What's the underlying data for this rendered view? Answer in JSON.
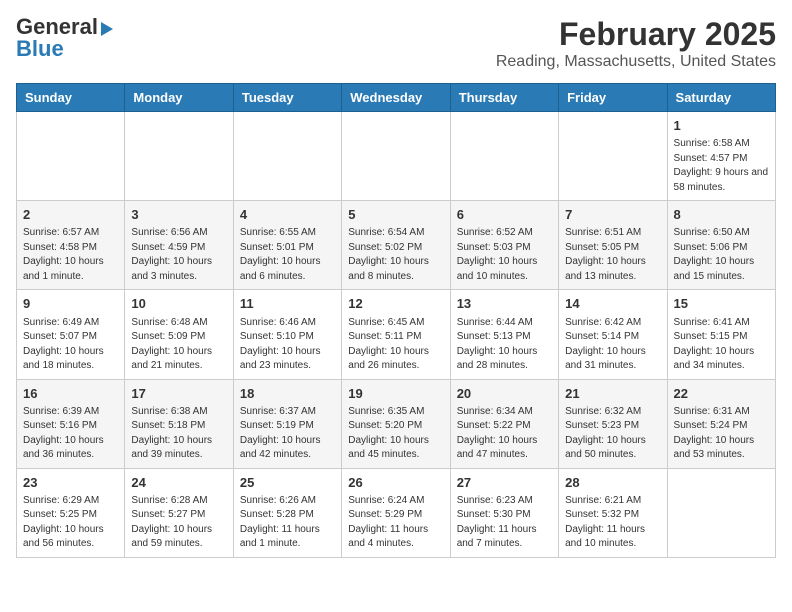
{
  "header": {
    "logo_general": "General",
    "logo_blue": "Blue",
    "month": "February 2025",
    "location": "Reading, Massachusetts, United States"
  },
  "weekdays": [
    "Sunday",
    "Monday",
    "Tuesday",
    "Wednesday",
    "Thursday",
    "Friday",
    "Saturday"
  ],
  "weeks": [
    [
      {
        "day": "",
        "info": ""
      },
      {
        "day": "",
        "info": ""
      },
      {
        "day": "",
        "info": ""
      },
      {
        "day": "",
        "info": ""
      },
      {
        "day": "",
        "info": ""
      },
      {
        "day": "",
        "info": ""
      },
      {
        "day": "1",
        "info": "Sunrise: 6:58 AM\nSunset: 4:57 PM\nDaylight: 9 hours and 58 minutes."
      }
    ],
    [
      {
        "day": "2",
        "info": "Sunrise: 6:57 AM\nSunset: 4:58 PM\nDaylight: 10 hours and 1 minute."
      },
      {
        "day": "3",
        "info": "Sunrise: 6:56 AM\nSunset: 4:59 PM\nDaylight: 10 hours and 3 minutes."
      },
      {
        "day": "4",
        "info": "Sunrise: 6:55 AM\nSunset: 5:01 PM\nDaylight: 10 hours and 6 minutes."
      },
      {
        "day": "5",
        "info": "Sunrise: 6:54 AM\nSunset: 5:02 PM\nDaylight: 10 hours and 8 minutes."
      },
      {
        "day": "6",
        "info": "Sunrise: 6:52 AM\nSunset: 5:03 PM\nDaylight: 10 hours and 10 minutes."
      },
      {
        "day": "7",
        "info": "Sunrise: 6:51 AM\nSunset: 5:05 PM\nDaylight: 10 hours and 13 minutes."
      },
      {
        "day": "8",
        "info": "Sunrise: 6:50 AM\nSunset: 5:06 PM\nDaylight: 10 hours and 15 minutes."
      }
    ],
    [
      {
        "day": "9",
        "info": "Sunrise: 6:49 AM\nSunset: 5:07 PM\nDaylight: 10 hours and 18 minutes."
      },
      {
        "day": "10",
        "info": "Sunrise: 6:48 AM\nSunset: 5:09 PM\nDaylight: 10 hours and 21 minutes."
      },
      {
        "day": "11",
        "info": "Sunrise: 6:46 AM\nSunset: 5:10 PM\nDaylight: 10 hours and 23 minutes."
      },
      {
        "day": "12",
        "info": "Sunrise: 6:45 AM\nSunset: 5:11 PM\nDaylight: 10 hours and 26 minutes."
      },
      {
        "day": "13",
        "info": "Sunrise: 6:44 AM\nSunset: 5:13 PM\nDaylight: 10 hours and 28 minutes."
      },
      {
        "day": "14",
        "info": "Sunrise: 6:42 AM\nSunset: 5:14 PM\nDaylight: 10 hours and 31 minutes."
      },
      {
        "day": "15",
        "info": "Sunrise: 6:41 AM\nSunset: 5:15 PM\nDaylight: 10 hours and 34 minutes."
      }
    ],
    [
      {
        "day": "16",
        "info": "Sunrise: 6:39 AM\nSunset: 5:16 PM\nDaylight: 10 hours and 36 minutes."
      },
      {
        "day": "17",
        "info": "Sunrise: 6:38 AM\nSunset: 5:18 PM\nDaylight: 10 hours and 39 minutes."
      },
      {
        "day": "18",
        "info": "Sunrise: 6:37 AM\nSunset: 5:19 PM\nDaylight: 10 hours and 42 minutes."
      },
      {
        "day": "19",
        "info": "Sunrise: 6:35 AM\nSunset: 5:20 PM\nDaylight: 10 hours and 45 minutes."
      },
      {
        "day": "20",
        "info": "Sunrise: 6:34 AM\nSunset: 5:22 PM\nDaylight: 10 hours and 47 minutes."
      },
      {
        "day": "21",
        "info": "Sunrise: 6:32 AM\nSunset: 5:23 PM\nDaylight: 10 hours and 50 minutes."
      },
      {
        "day": "22",
        "info": "Sunrise: 6:31 AM\nSunset: 5:24 PM\nDaylight: 10 hours and 53 minutes."
      }
    ],
    [
      {
        "day": "23",
        "info": "Sunrise: 6:29 AM\nSunset: 5:25 PM\nDaylight: 10 hours and 56 minutes."
      },
      {
        "day": "24",
        "info": "Sunrise: 6:28 AM\nSunset: 5:27 PM\nDaylight: 10 hours and 59 minutes."
      },
      {
        "day": "25",
        "info": "Sunrise: 6:26 AM\nSunset: 5:28 PM\nDaylight: 11 hours and 1 minute."
      },
      {
        "day": "26",
        "info": "Sunrise: 6:24 AM\nSunset: 5:29 PM\nDaylight: 11 hours and 4 minutes."
      },
      {
        "day": "27",
        "info": "Sunrise: 6:23 AM\nSunset: 5:30 PM\nDaylight: 11 hours and 7 minutes."
      },
      {
        "day": "28",
        "info": "Sunrise: 6:21 AM\nSunset: 5:32 PM\nDaylight: 11 hours and 10 minutes."
      },
      {
        "day": "",
        "info": ""
      }
    ]
  ]
}
